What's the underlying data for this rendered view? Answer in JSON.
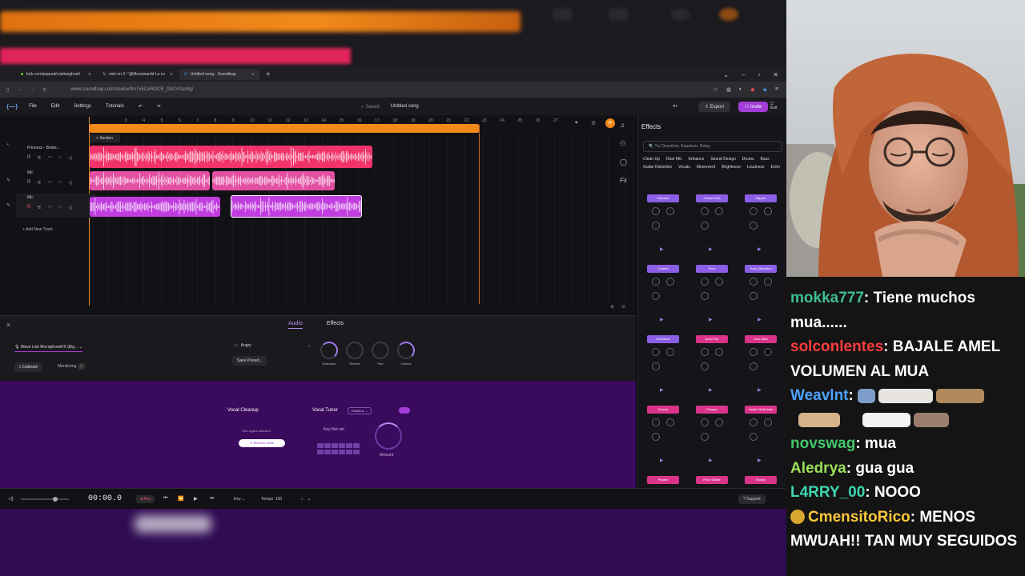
{
  "browser": {
    "tabs": [
      {
        "label": "kick.com/popout/cristianghost/",
        "active": false
      },
      {
        "label": "nick on X: \"@Moonwardd La co",
        "active": false
      },
      {
        "label": "Untitled song - Soundtrap",
        "active": true
      }
    ],
    "url": "www.soundtrap.com/studio/9m7x5CeRDCR_Gb2VSaWg/"
  },
  "app": {
    "menu": [
      "File",
      "Edit",
      "Settings",
      "Tutorials"
    ],
    "saved_label": "Saved",
    "song_title": "Untitled song",
    "export_label": "Export",
    "invite_label": "Invite",
    "exit_label": "Exit"
  },
  "arrange": {
    "section_label": "Section",
    "ruler": [
      "1",
      "3",
      "4",
      "5",
      "6",
      "7",
      "8",
      "9",
      "10",
      "11",
      "12",
      "13",
      "14",
      "15",
      "16",
      "17",
      "18",
      "19",
      "20",
      "21",
      "22",
      "23",
      "24",
      "25",
      "26",
      "27"
    ],
    "tracks": [
      {
        "name": "Princess - Broke...",
        "color": "#f0336a"
      },
      {
        "name": "Mic",
        "color": "#e24fa3"
      },
      {
        "name": "Mic",
        "color": "#c13de0"
      }
    ],
    "add_track_label": "+ Add New Track"
  },
  "effects_panel": {
    "title": "Effects",
    "search_placeholder": "Try Overdrive, Equalizer, Delay",
    "categories": [
      "Clean Up",
      "Glue Mix",
      "Enhance",
      "Sound Design",
      "Drums",
      "Bass",
      "Guitar Distortion",
      "Vocals",
      "Movement",
      "Brightness",
      "Loudness",
      "Echo"
    ],
    "cards": [
      {
        "name": "Distorter",
        "color": "#8b5ee8"
      },
      {
        "name": "Classic Dist",
        "color": "#8b5ee8"
      },
      {
        "name": "Clipper",
        "color": "#8b5ee8"
      },
      {
        "name": "Crusher",
        "color": "#8b5ee8"
      },
      {
        "name": "Fuzz",
        "color": "#8b5ee8"
      },
      {
        "name": "Juicy Distortion",
        "color": "#8b5ee8"
      },
      {
        "name": "Overdrive",
        "color": "#8b5ee8"
      },
      {
        "name": "Auto-Pan",
        "color": "#d9348a"
      },
      {
        "name": "Auto-Wah",
        "color": "#d9348a"
      },
      {
        "name": "Chorus",
        "color": "#d9348a"
      },
      {
        "name": "Flanger",
        "color": "#d9348a"
      },
      {
        "name": "Instant Sidechain",
        "color": "#d9348a"
      },
      {
        "name": "Phaser",
        "color": "#d9348a"
      },
      {
        "name": "Pitch Shifter",
        "color": "#d9348a"
      },
      {
        "name": "Rotary",
        "color": "#d9348a"
      }
    ]
  },
  "editor": {
    "tabs": [
      "Audio",
      "Effects"
    ],
    "active_tab": "Audio",
    "mic_device": "Wave Link MicrophoneFX (Elg...",
    "calibrate_label": "Calibrate",
    "monitoring_label": "Monitoring",
    "preset": "Angry",
    "save_preset_label": "Save Preset...",
    "knobs": [
      "Distortion",
      "Reverb",
      "Pan",
      "Volume"
    ]
  },
  "vocal": {
    "cleanup_title": "Vocal Cleanup",
    "cleanup_hint": "One region selected",
    "remove_noise_label": "Remove noise",
    "tuner_title": "Vocal Tuner",
    "tuner_mode": "Realtime",
    "key_label": "Key",
    "key_value": "Not set",
    "amount_label": "Amount"
  },
  "transport": {
    "time": "00:00.0",
    "rec_label": "Rec",
    "key_label": "Key",
    "tempo_label": "Tempo",
    "tempo_value": "130",
    "support_label": "Support"
  },
  "chat": [
    {
      "user": "mokka777",
      "color": "#3fbf8f",
      "text": "Tiene muchos mua......"
    },
    {
      "user": "solconlentes",
      "color": "#ff3d3d",
      "text": "BAJALE AMEL VOLUMEN AL MUA"
    },
    {
      "user": "Weavlnt",
      "color": "#4ea2ff",
      "text": ""
    },
    {
      "user": "novswag",
      "color": "#43c76b",
      "text": "mua"
    },
    {
      "user": "Aledrya",
      "color": "#9be05a",
      "text": "gua gua"
    },
    {
      "user": "L4RRY_00",
      "color": "#3fd6b2",
      "text": "NOOO"
    },
    {
      "user": "CmensitoRico",
      "color": "#ffc83a",
      "text": "MENOS MWUAH!! TAN MUY SEGUIDOS"
    }
  ]
}
